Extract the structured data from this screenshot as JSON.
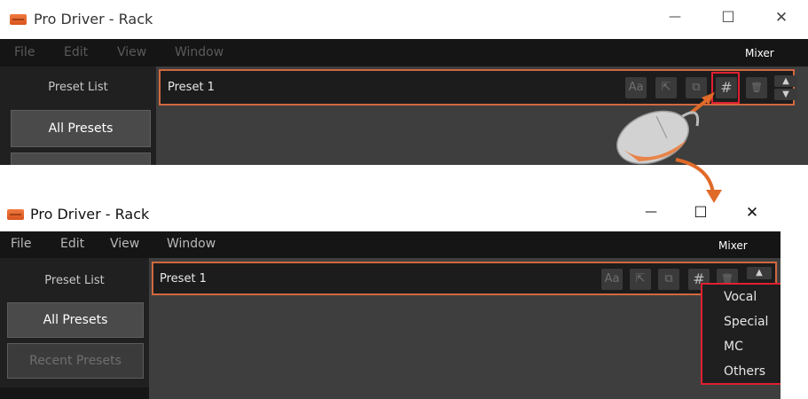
{
  "top_window": {
    "title": "Pro Driver - Rack",
    "controls": {
      "minimize": "—",
      "maximize": "☐",
      "close": "✕"
    },
    "menu": [
      "File",
      "Edit",
      "View",
      "Window"
    ],
    "mixer_label": "Mixer",
    "sidebar": {
      "title": "Preset List",
      "buttons": [
        "All Presets"
      ]
    },
    "preset_name": "Preset 1",
    "toolbar": {
      "font": "Aa",
      "export": "⇱",
      "copy": "⧉",
      "category": "#",
      "delete": "🗑"
    }
  },
  "bottom_window": {
    "title": "Pro Driver - Rack",
    "controls": {
      "minimize": "—",
      "maximize": "☐",
      "close": "✕"
    },
    "menu": [
      "File",
      "Edit",
      "View",
      "Window"
    ],
    "mixer_label": "Mixer",
    "sidebar": {
      "title": "Preset List",
      "buttons": [
        "All Presets",
        "Recent Presets"
      ]
    },
    "preset_name": "Preset 1",
    "toolbar": {
      "font": "Aa",
      "export": "⇱",
      "copy": "⧉",
      "category": "#",
      "delete": "🗑"
    },
    "dropdown": [
      "Vocal",
      "Special",
      "MC",
      "Others"
    ]
  },
  "colors": {
    "accent_orange": "#d1683f",
    "highlight_red": "#e02030"
  }
}
